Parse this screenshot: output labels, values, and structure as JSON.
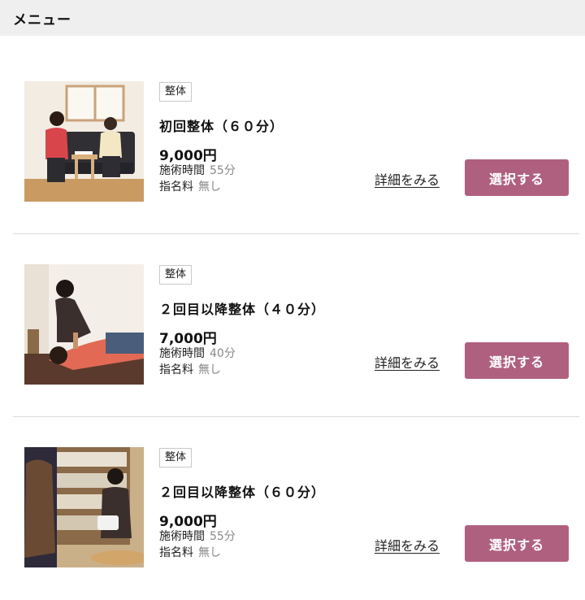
{
  "header": {
    "title": "メニュー"
  },
  "menu_items": [
    {
      "tag": "整体",
      "title": "初回整体（６０分）",
      "price": "9,000円",
      "duration_label": "施術時間",
      "duration_value": "55分",
      "nomination_label": "指名料",
      "nomination_value": "無し",
      "detail_link": "詳細をみる",
      "select_button": "選択する"
    },
    {
      "tag": "整体",
      "title": "２回目以降整体（４０分）",
      "price": "7,000円",
      "duration_label": "施術時間",
      "duration_value": "40分",
      "nomination_label": "指名料",
      "nomination_value": "無し",
      "detail_link": "詳細をみる",
      "select_button": "選択する"
    },
    {
      "tag": "整体",
      "title": "２回目以降整体（６０分）",
      "price": "9,000円",
      "duration_label": "施術時間",
      "duration_value": "55分",
      "nomination_label": "指名料",
      "nomination_value": "無し",
      "detail_link": "詳細をみる",
      "select_button": "選択する"
    }
  ],
  "colors": {
    "select_button_bg": "#b0607f",
    "header_bg": "#efefef"
  }
}
